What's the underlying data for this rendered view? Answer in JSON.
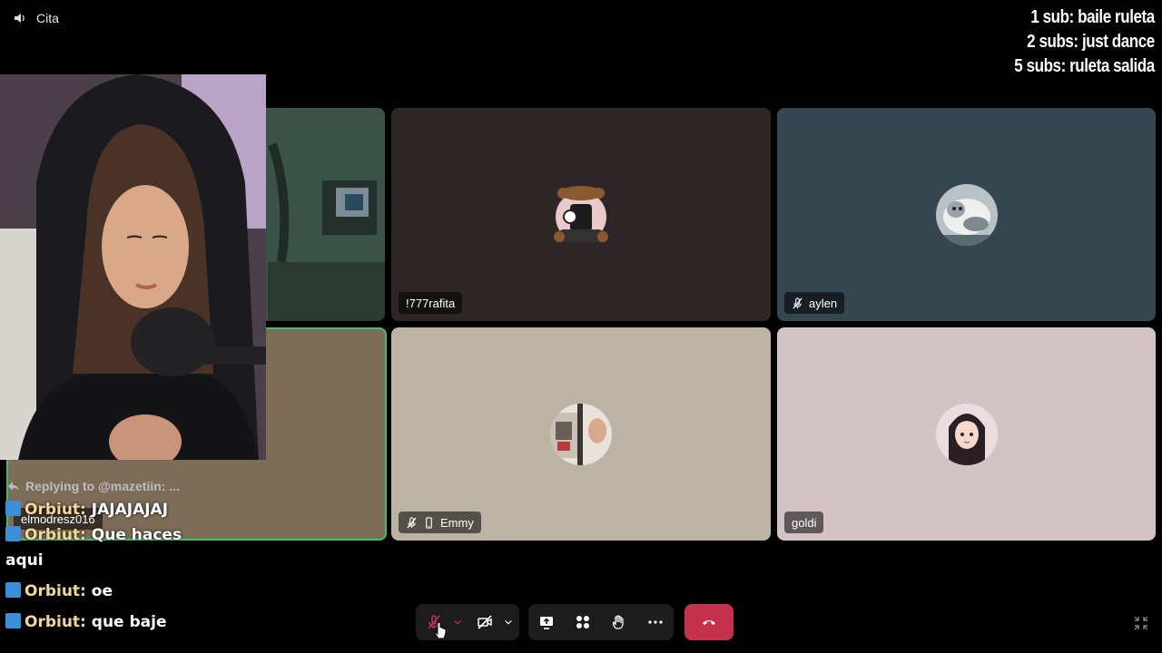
{
  "window": {
    "title": "Cita"
  },
  "overlay": {
    "lines": [
      "1 sub: baile ruleta",
      "2 subs: just dance",
      "5 subs: ruleta salida"
    ]
  },
  "participants": [
    {
      "name": "",
      "muted": false
    },
    {
      "name": "!777rafita",
      "muted": false
    },
    {
      "name": "aylen",
      "muted": true
    },
    {
      "name": "elmodresz016",
      "muted": false
    },
    {
      "name": "Emmy",
      "muted": true,
      "phone": true
    },
    {
      "name": "goldi",
      "muted": false
    }
  ],
  "chat": {
    "reply_to": "Replying to @mazetiin: ...",
    "messages": [
      {
        "user": "Orbiut:",
        "text": " JAJAJAJAJ"
      },
      {
        "user": "Orbiut:",
        "text": " Que haces aqui"
      },
      {
        "user": "Orbiut:",
        "text": " oe"
      },
      {
        "user": "Orbiut:",
        "text": " que baje"
      }
    ]
  },
  "colors": {
    "leave": "#c4314b",
    "mic_off": "#c4314b",
    "active_speaker": "#3fbf6a"
  },
  "icons": [
    "speaker-icon",
    "mic-off-icon",
    "camera-off-icon",
    "share-screen-icon",
    "apps-icon",
    "raise-hand-icon",
    "more-icon",
    "hang-up-icon",
    "exit-fullscreen-icon"
  ]
}
